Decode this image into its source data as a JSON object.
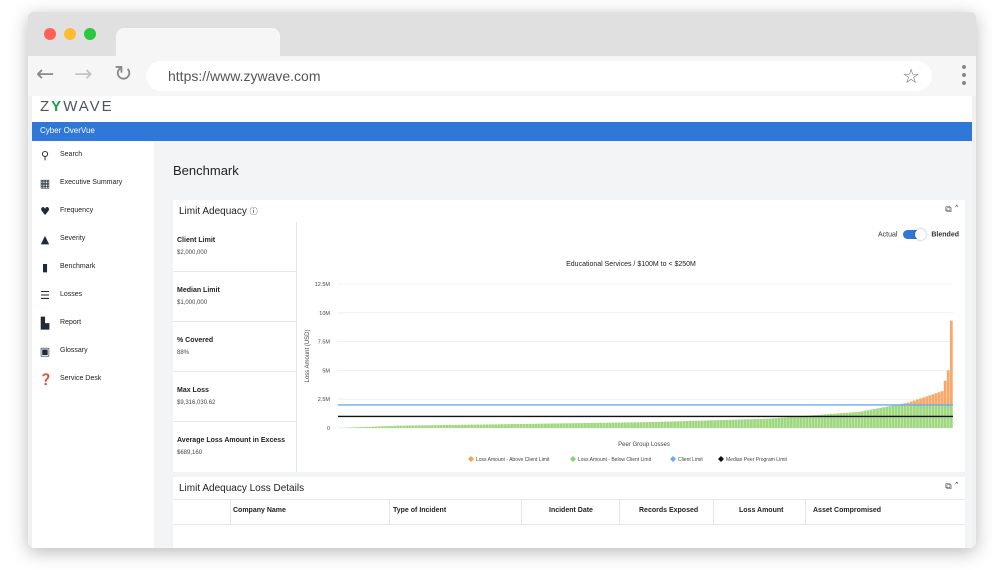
{
  "browser": {
    "url": "https://www.zywave.com",
    "traffic_colors": [
      "#ff5f57",
      "#febc2e",
      "#28c840"
    ]
  },
  "app": {
    "logo_prefix": "Z",
    "logo_y": "Y",
    "logo_suffix": "WAVE",
    "product_bar": "Cyber OverVue",
    "accent": "#2f78d8"
  },
  "sidebar": {
    "items": [
      {
        "label": "Search",
        "icon": "search-icon"
      },
      {
        "label": "Executive Summary",
        "icon": "dashboard-icon"
      },
      {
        "label": "Frequency",
        "icon": "heartbeat-icon"
      },
      {
        "label": "Severity",
        "icon": "severity-icon"
      },
      {
        "label": "Benchmark",
        "icon": "bar-chart-icon"
      },
      {
        "label": "Losses",
        "icon": "list-icon"
      },
      {
        "label": "Report",
        "icon": "report-icon"
      },
      {
        "label": "Glossary",
        "icon": "book-icon"
      },
      {
        "label": "Service Desk",
        "icon": "help-icon"
      }
    ]
  },
  "main": {
    "title": "Benchmark",
    "limit_card": {
      "title": "Limit Adequacy",
      "toggle_left": "Actual",
      "toggle_right": "Blended",
      "stats": [
        {
          "label": "Client Limit",
          "value": "$2,000,000"
        },
        {
          "label": "Median Limit",
          "value": "$1,000,000"
        },
        {
          "label": "% Covered",
          "value": "88%"
        },
        {
          "label": "Max Loss",
          "value": "$9,316,030.62"
        },
        {
          "label": "Average Loss Amount in Excess",
          "value": "$689,160"
        }
      ]
    },
    "details_card": {
      "title": "Limit Adequacy Loss Details",
      "columns": [
        "Company Name",
        "Type of Incident",
        "Incident Date",
        "Records Exposed",
        "Loss Amount",
        "Asset Compromised"
      ]
    }
  },
  "chart_data": {
    "type": "area",
    "title": "Educational Services / $100M to < $250M",
    "xlabel": "Peer Group Losses",
    "ylabel": "Loss Amount (USD)",
    "yticks": [
      "0",
      "2.5M",
      "5M",
      "7.5M",
      "10M",
      "12.5M"
    ],
    "ylim": [
      0,
      12500000
    ],
    "n_points": 200,
    "loss_curve": {
      "name_below": "Loss Amount - Below Client Limit",
      "name_above": "Loss Amount - Above Client Limit",
      "color_below": "#8fd16a",
      "color_above": "#f5a05a",
      "anchors": [
        [
          0,
          0
        ],
        [
          0.1,
          200000
        ],
        [
          0.3,
          350000
        ],
        [
          0.5,
          500000
        ],
        [
          0.7,
          800000
        ],
        [
          0.85,
          1400000
        ],
        [
          0.93,
          2200000
        ],
        [
          0.985,
          3200000
        ],
        [
          0.995,
          5000000
        ],
        [
          1.0,
          9316030
        ]
      ]
    },
    "client_limit": {
      "name": "Client Limit",
      "value": 2000000,
      "color": "#6ea8f7"
    },
    "median_limit": {
      "name": "Median Peer Program Limit",
      "value": 1000000,
      "color": "#111111"
    },
    "legend": [
      "Loss Amount - Above Client Limit",
      "Loss Amount - Below Client Limit",
      "Client Limit",
      "Median Peer Program Limit"
    ],
    "legend_colors": [
      "#f5a05a",
      "#8fd16a",
      "#6ea8f7",
      "#111111"
    ],
    "legend_position": "bottom",
    "grid": true
  }
}
